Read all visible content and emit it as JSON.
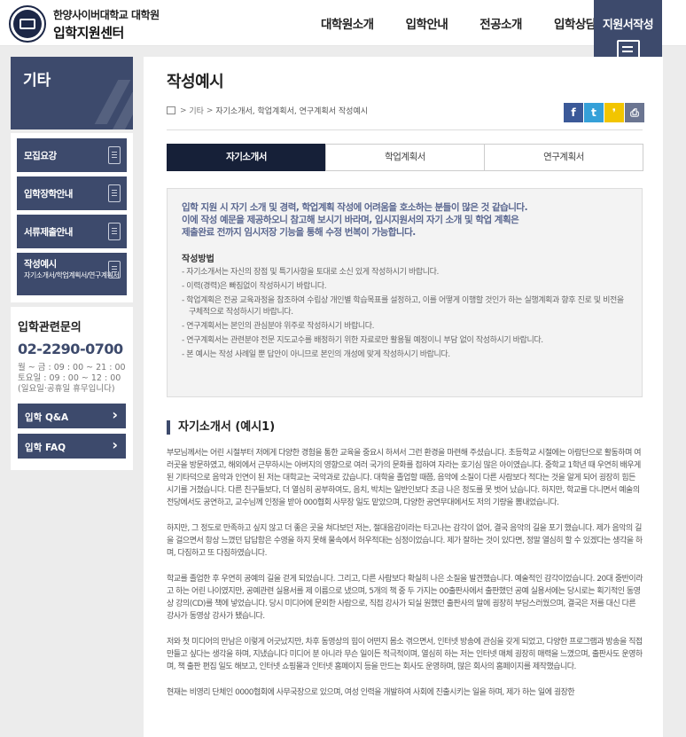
{
  "header": {
    "school_name": "한양사이버대학교 대학원",
    "center_name": "입학지원센터",
    "nav": [
      "대학원소개",
      "입학안내",
      "전공소개",
      "입학상담"
    ],
    "apply_label": "지원서작성"
  },
  "sidebar": {
    "title": "기타",
    "items": [
      {
        "label": "모집요강"
      },
      {
        "label": "입학장학안내"
      },
      {
        "label": "서류제출안내"
      },
      {
        "label": "작성예시",
        "sub": "자기소개서/학업계획서/연구계획서"
      }
    ],
    "contact": {
      "title": "입학관련문의",
      "phone": "02-2290-0700",
      "hours": [
        "월 ~ 금 : 09 : 00 ~ 21 : 00",
        "토요일 : 09 : 00 ~ 12 : 00",
        "(일요일·공휴일 휴무입니다)"
      ],
      "buttons": [
        "입학 Q&A",
        "입학 FAQ"
      ]
    }
  },
  "main": {
    "title": "작성예시",
    "breadcrumb": {
      "level1": "기타",
      "current": "자기소개서, 학업계획서, 연구계획서 작성예시"
    },
    "social": [
      {
        "icon": "facebook-icon",
        "glyph": "f",
        "color": "#3b5998"
      },
      {
        "icon": "twitter-icon",
        "glyph": "t",
        "color": "#35a0d8"
      },
      {
        "icon": "kakao-icon",
        "glyph": "❜",
        "color": "#f2c500"
      },
      {
        "icon": "print-icon",
        "glyph": "⎙",
        "color": "#6b7591"
      }
    ],
    "tabs": [
      "자기소개서",
      "학업계획서",
      "연구계획서"
    ],
    "intro": [
      "입학 지원 시 자기 소개 및 경력, 학업계획 작성에 어려움을 호소하는 분들이 많은 것 같습니다.",
      "이에 작성 예문을 제공하오니 참고해 보시기 바라며, 입시지원서의 자기 소개 및 학업 계획은",
      "제출완료 전까지 임시저장 기능을 통해 수정 번복이 가능합니다."
    ],
    "how_title": "작성방법",
    "rules": [
      "- 자기소개서는 자신의 장점 및 특기사항을 토대로 소신 있게 작성하시기 바랍니다.",
      "- 이력(경력)은 빠짐없이 작성하시기 바랍니다.",
      "- 학업계획은 전공 교육과정을 참조하여 수립상 개인별 학습목표를 설정하고, 이를 어떻게 이행할 것인가 하는 실행계획과 향후 진로 및 비전을 구체적으로 작성하시기 바랍니다.",
      "- 연구계획서는 본인의 관심분야 위주로 작성하시기 바랍니다.",
      "- 연구계획서는 관련분야 전문 지도교수를 배정하기 위한 자료로만 활용될 예정이니 부담 없이 작성하시기 바랍니다.",
      "- 본 예시는 작성 사례일 뿐 답안이 아니므로 본인의 개성에 맞게 작성하시기 바랍니다."
    ],
    "section_title": "자기소개서 (예시1)",
    "paragraphs": [
      "부모님께서는 어린 시절부터 저에게 다양한 경험을 통한 교육을 중요시 하셔서 그런 환경을 마련해 주셨습니다. 초등학교 시절에는 아람단으로 활동하며 여러곳을 방문하였고, 해외에서 근무하시는 아버지의 영향으로 여러 국가의 문화를 접하여 자라는 호기심 많은 아이였습니다. 중학교 1학년 때 우연히 배우게 된 기타덕으로 음악과 인연이 된 저는 대학교는 국악과로 갔습니다. 대학을 졸업할 때쯤, 음악에 소질이 다른 사람보다 적다는 것을 알게 되어 굉장히 힘든 시기를 거쳤습니다. 다른 친구들보다, 더 열심히 공부하여도, 음치, 박치는 일반인보다 조금 나은 정도를 못 벗어 났습니다. 하지만, 학교를 다니면서 예술의 전당에서도 공연하고, 교수님께 인정을 받아 000협회 사무장 일도 맡았으며, 다양한 공연무대에서도 저의 기량을 뽐내었습니다.",
      "하지만, 그 정도로 만족하고 싶지 않고 더 좋은 곳을 쳐다보던 저는, 절대음감이라는 타고나는 감각이 없어, 결국 음악의 길을 포기 했습니다. 제가 음악의 길을 걸으면서 항상 느꼈던 답답함은 수영을 하지 못해 물속에서 허우적대는 심정이었습니다. 제가 잘하는 것이 있다면, 정말 열심히 할 수 있겠다는 생각을 하며, 다짐하고 또 다짐하였습니다.",
      "학교를 졸업한 후 우연히 공예의 길을 걷게 되었습니다. 그리고, 다른 사람보다 확실히 나은 소질을 발견했습니다. 예술적인 감각이었습니다. 20대 중반이라고 하는 어린 나이였지만, 공예관련 실용서를 제 이름으로 냈으며, 5개의 책 중 두 가지는 00출판사에서 출판했던 공예 실용서에는 당시로는 획기적인 동영상 강의(CD)를 책에 넣었습니다. 당시 미디어에 문외한 사람으로, 직접 강사가 되실 원했던 출판사의 말에 굉장히 부담스러웠으며, 결국은 저를 대신 다른 강사가 동영상 강사가 됐습니다.",
      "저와 첫 미디어의 만남은 이렇게 어긋났지만, 차후 동영상의 힘이 어떤지 몸소 겪으면서, 인터넷 방송에 관심을 갖게 되었고, 다양한 프로그램과 방송을 직접 만들고 싶다는 생각을 하며, 지냈습니다 미디어 분 아니라 무슨 일이든 적극적이며, 열심히 하는 저는 인터넷 매체 굉장히 매력을 느꼈으며, 출판사도 운영하며, 책 출판 편집 일도 해보고, 인터넷 쇼핑몰과 인터넷 홈페이지 등을 만드는 회사도 운영하며, 많은 회사의 홈페이지를 제작했습니다.",
      "현재는 비영리 단체인 0000협회에 사무국장으로 있으며, 여성 인력을 개발하여 사회에 진출시키는 일을 하며, 제가 하는 일에 굉장한"
    ]
  },
  "colors": {
    "primary": "#3d4a6c",
    "tab_active": "#162038",
    "intro_text": "#5a6790"
  }
}
